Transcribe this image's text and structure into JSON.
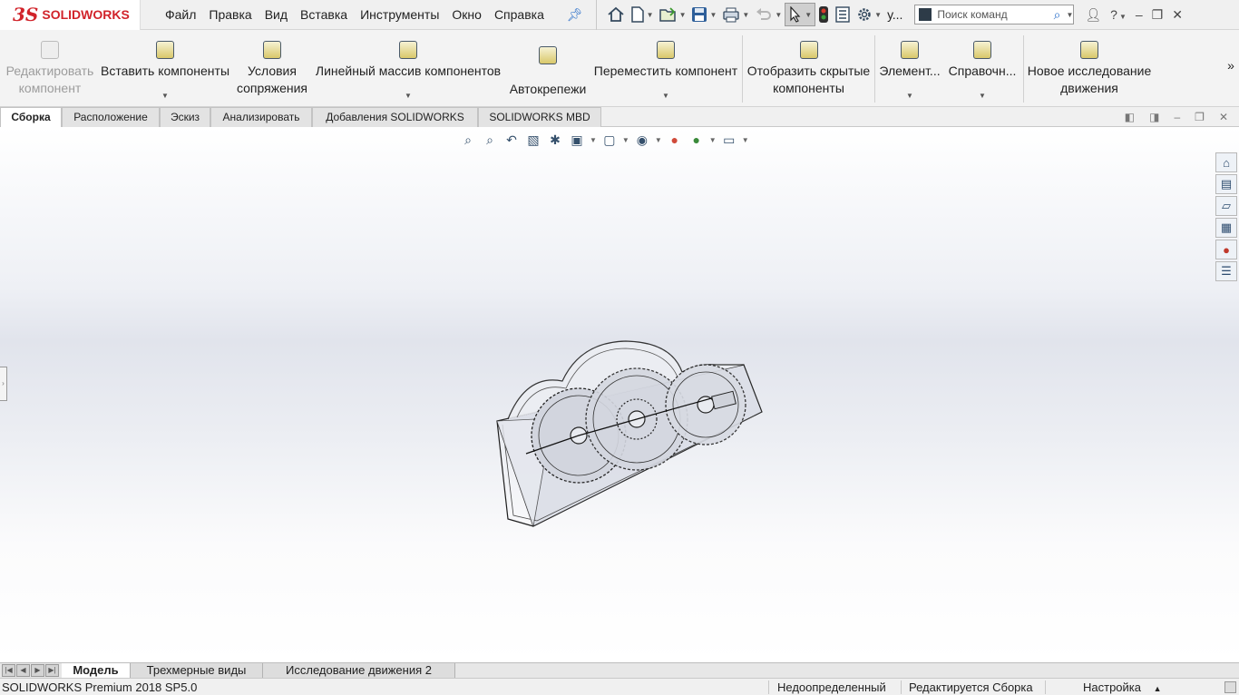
{
  "app": {
    "brand_ds": "3S",
    "brand_name": "SOLIDWORKS"
  },
  "menu": [
    "Файл",
    "Правка",
    "Вид",
    "Вставка",
    "Инструменты",
    "Окно",
    "Справка"
  ],
  "toolbar": {
    "user_label": "у...",
    "search_placeholder": "Поиск команд",
    "help_label": "?"
  },
  "ribbon": {
    "edit_component": "Редактировать компонент",
    "insert_components": "Вставить компоненты",
    "mates": "Условия сопряжения",
    "linear_pattern": "Линейный массив компонентов",
    "smart_fasteners": "Автокрепежи",
    "move_component": "Переместить компонент",
    "show_hidden": "Отобразить скрытые компоненты",
    "features": "Элемент...",
    "reference": "Справочн...",
    "motion_study": "Новое исследование движения",
    "more": "»"
  },
  "tabs": [
    "Сборка",
    "Расположение",
    "Эскиз",
    "Анализировать",
    "Добавления SOLIDWORKS",
    "SOLIDWORKS MBD"
  ],
  "active_tab": "Сборка",
  "bottom_tabs": [
    "Модель",
    "Трехмерные виды",
    "Исследование движения 2"
  ],
  "active_bottom_tab": "Модель",
  "status": {
    "product": "SOLIDWORKS Premium 2018 SP5.0",
    "definition": "Недоопределенный",
    "mode": "Редактируется Сборка",
    "settings": "Настройка",
    "settings_caret": "▲"
  },
  "colors": {
    "brand_red": "#d1232a",
    "accent_blue": "#2a6fc9"
  }
}
